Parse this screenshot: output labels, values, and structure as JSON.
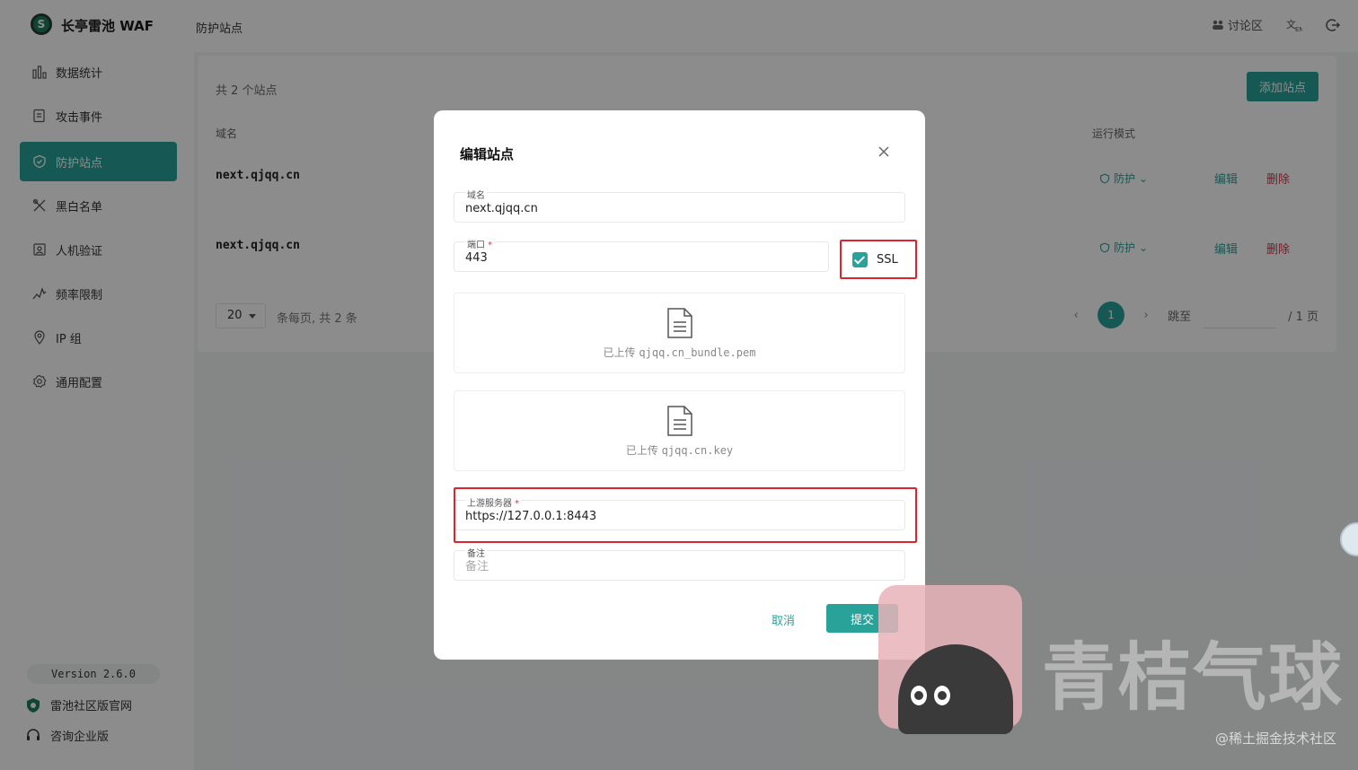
{
  "app": {
    "brand": "长亭雷池 WAF",
    "breadcrumb": "防护站点"
  },
  "topbar": {
    "forum_label": "讨论区",
    "lang_icon": "translate-icon",
    "logout_icon": "logout-icon"
  },
  "sidebar": {
    "items": [
      {
        "label": "数据统计",
        "icon": "bar-chart-icon",
        "active": false
      },
      {
        "label": "攻击事件",
        "icon": "document-icon",
        "active": false
      },
      {
        "label": "防护站点",
        "icon": "shield-icon",
        "active": true
      },
      {
        "label": "黑白名单",
        "icon": "tools-icon",
        "active": false
      },
      {
        "label": "人机验证",
        "icon": "verify-icon",
        "active": false
      },
      {
        "label": "频率限制",
        "icon": "speed-icon",
        "active": false
      },
      {
        "label": "IP 组",
        "icon": "location-icon",
        "active": false
      },
      {
        "label": "通用配置",
        "icon": "gear-icon",
        "active": false
      }
    ],
    "version": "Version 2.6.0",
    "community_link": "雷池社区版官网",
    "enterprise_link": "咨询企业版"
  },
  "sites": {
    "total_text": "共 2 个站点",
    "add_button": "添加站点",
    "columns": {
      "domain": "域名",
      "mode": "运行模式"
    },
    "rows": [
      {
        "domain": "next.qjqq.cn",
        "mode": "防护",
        "edit": "编辑",
        "delete": "删除"
      },
      {
        "domain": "next.qjqq.cn",
        "mode": "防护",
        "edit": "编辑",
        "delete": "删除"
      }
    ],
    "page_size": "20",
    "page_size_text": "条每页, 共 2 条",
    "current_page": "1",
    "jump_label": "跳至",
    "total_pages": "/ 1 页"
  },
  "modal": {
    "title": "编辑站点",
    "domain_label": "域名",
    "domain_value": "next.qjqq.cn",
    "port_label": "端口",
    "port_value": "443",
    "ssl_label": "SSL",
    "ssl_checked": true,
    "cert_prefix": "已上传",
    "cert_file": "qjqq.cn_bundle.pem",
    "key_prefix": "已上传",
    "key_file": "qjqq.cn.key",
    "upstream_label": "上游服务器",
    "upstream_value": "https://127.0.0.1:8443",
    "note_label": "备注",
    "note_placeholder": "备注",
    "cancel": "取消",
    "submit": "提交"
  },
  "watermark": {
    "main": "青桔气球",
    "credit": "@稀土掘金技术社区"
  },
  "colors": {
    "accent": "#29a39a",
    "danger": "#e0304b",
    "highlight": "#d9262e"
  }
}
